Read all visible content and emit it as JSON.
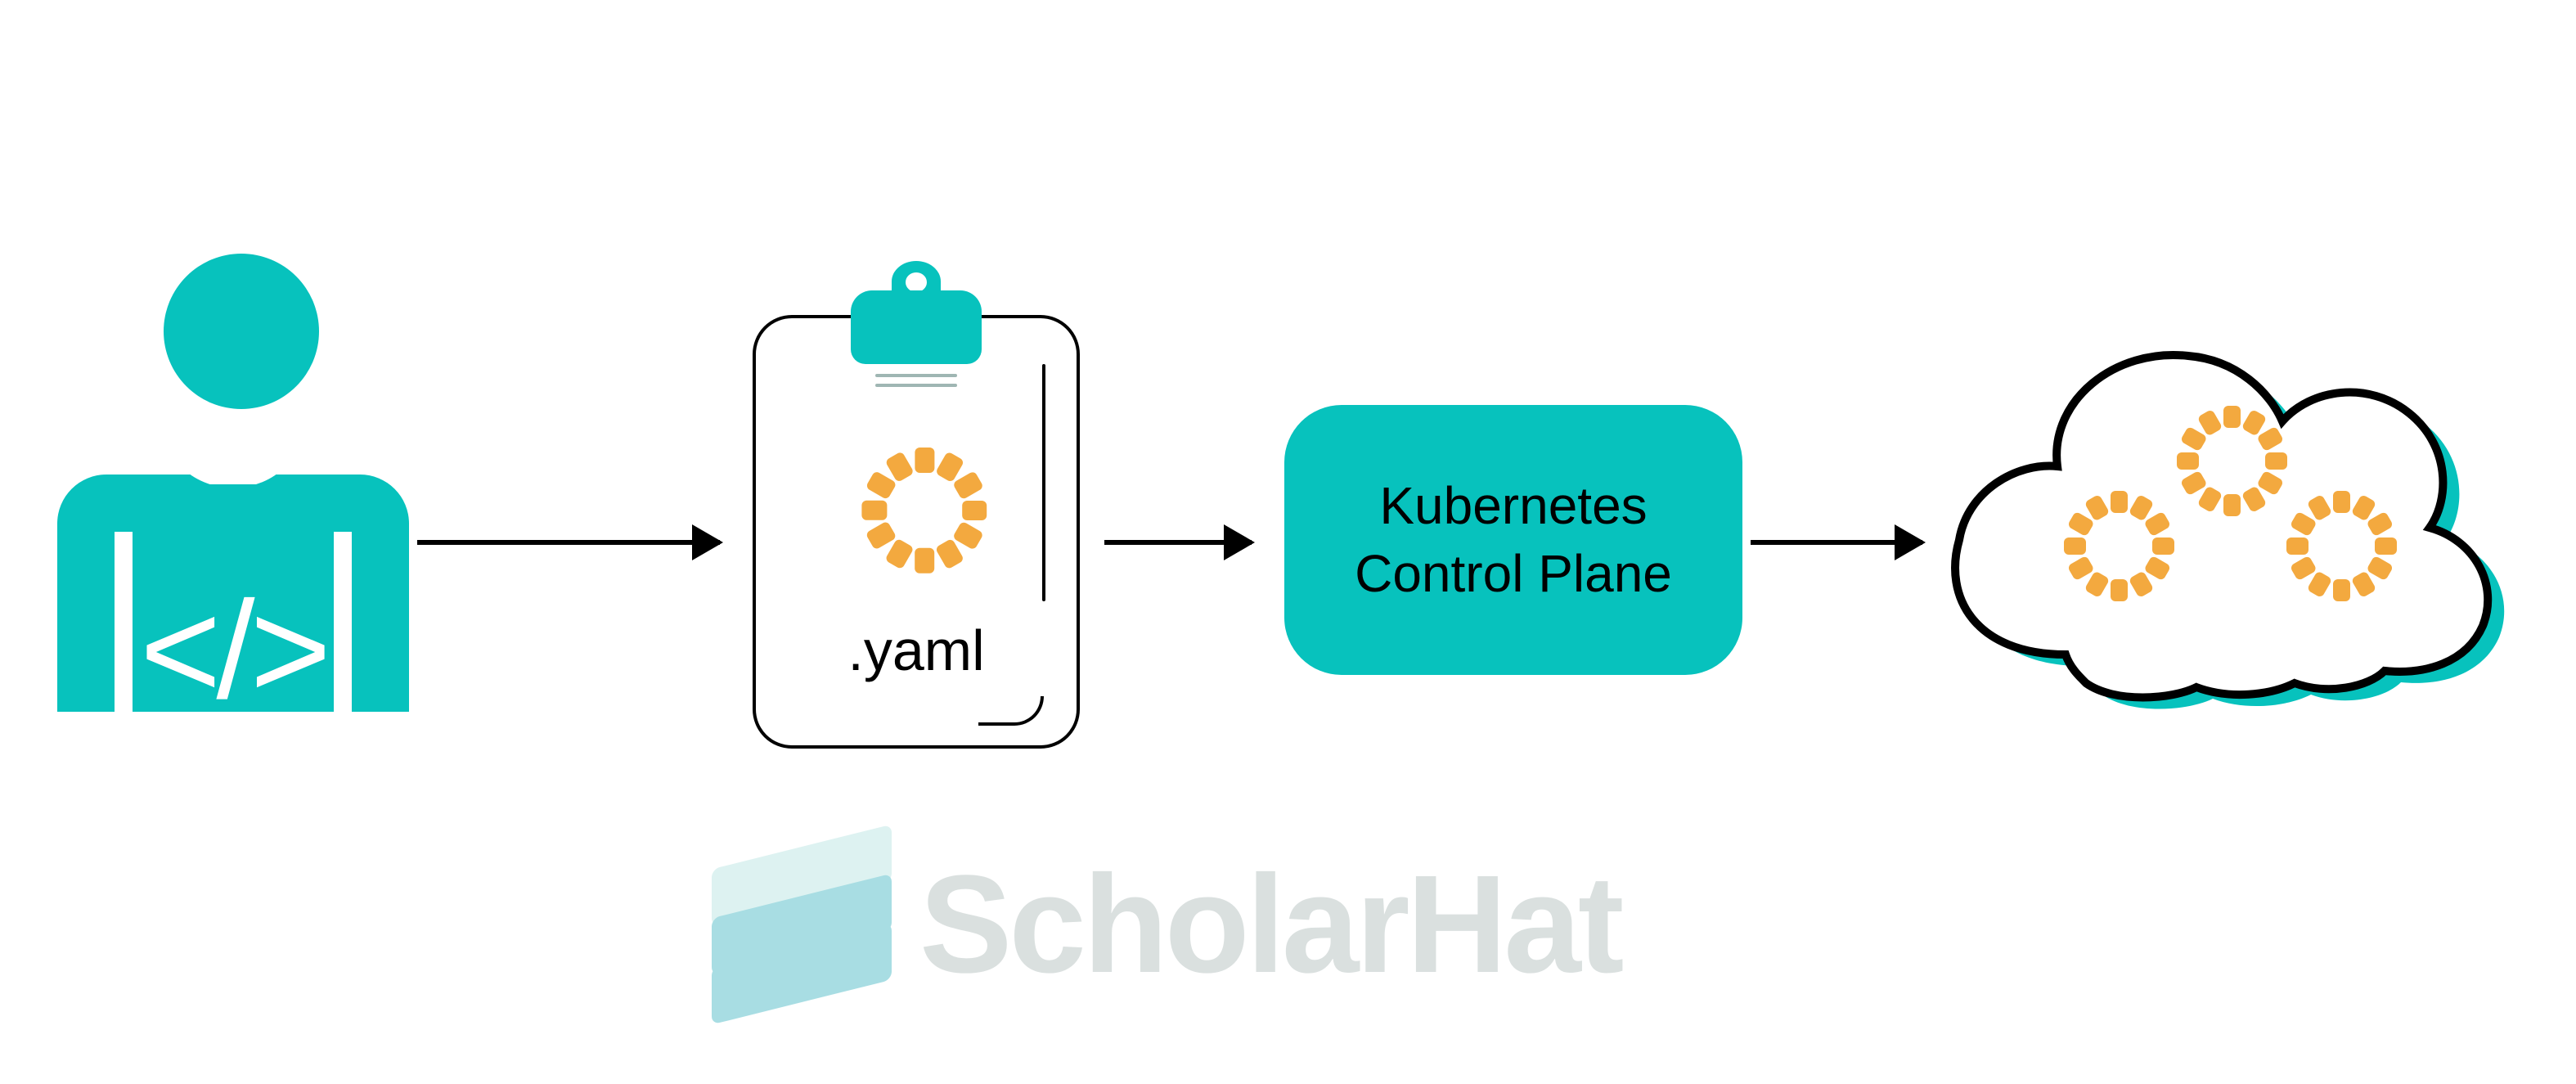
{
  "developer": {
    "code_glyph": "</>"
  },
  "clipboard": {
    "label": ".yaml"
  },
  "control_plane": {
    "label": "Kubernetes\nControl Plane"
  },
  "watermark": {
    "text": "ScholarHat"
  },
  "colors": {
    "teal": "#07c2bd",
    "orange": "#f3a93f"
  }
}
